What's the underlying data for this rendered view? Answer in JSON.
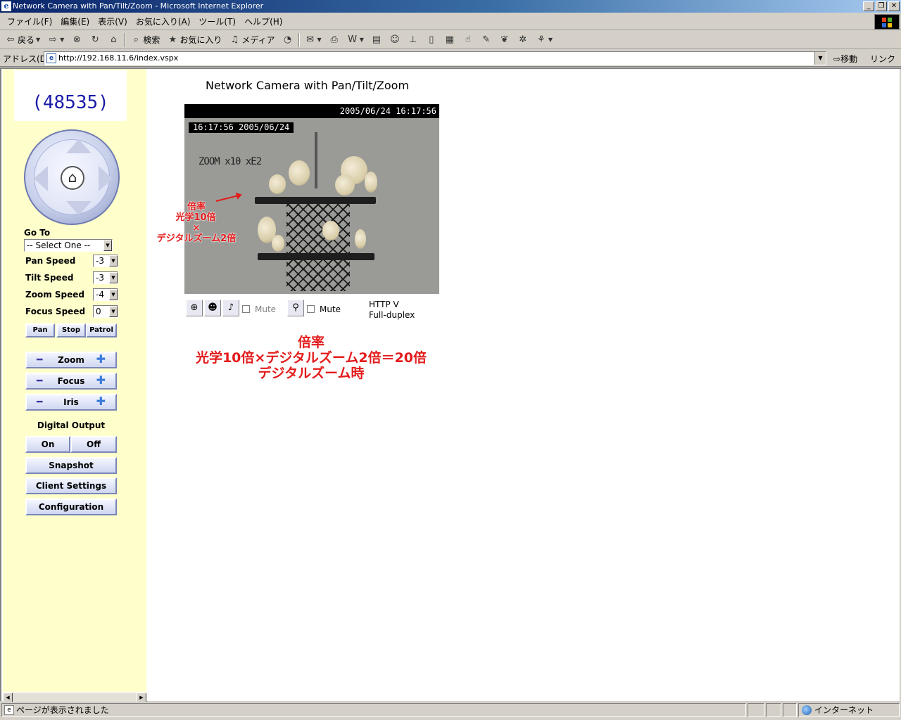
{
  "window": {
    "title": "Network Camera with Pan/Tilt/Zoom - Microsoft Internet Explorer",
    "controls": [
      "_",
      "❐",
      "✕"
    ]
  },
  "menubar": [
    "ファイル(F)",
    "編集(E)",
    "表示(V)",
    "お気に入り(A)",
    "ツール(T)",
    "ヘルプ(H)"
  ],
  "toolbar": {
    "back_label": "戻る",
    "search_label": "検索",
    "favorites_label": "お気に入り",
    "media_label": "メディア"
  },
  "address": {
    "label": "アドレス(D)",
    "url": "http://192.168.11.6/index.vspx",
    "go_label": "移動",
    "links_label": "リンク"
  },
  "left_panel": {
    "logo_text": "(48535)",
    "goto_label": "Go To",
    "goto_value": "-- Select One --",
    "speeds": [
      {
        "label": "Pan Speed",
        "value": "-3"
      },
      {
        "label": "Tilt Speed",
        "value": "-3"
      },
      {
        "label": "Zoom Speed",
        "value": "-4"
      },
      {
        "label": "Focus Speed",
        "value": "0"
      }
    ],
    "motion_buttons": [
      "Pan",
      "Stop",
      "Patrol"
    ],
    "adjust_buttons": [
      "Zoom",
      "Focus",
      "Iris"
    ],
    "digital_output_label": "Digital Output",
    "do_on": "On",
    "do_off": "Off",
    "snapshot_label": "Snapshot",
    "client_settings_label": "Client Settings",
    "configuration_label": "Configuration"
  },
  "main": {
    "title": "Network Camera with Pan/Tilt/Zoom",
    "camera_timestamp": "2005/06/24 16:17:56",
    "osd_time": "16:17:56 2005/06/24",
    "osd_zoom": "ZOOM x10 xE2",
    "annotation_small": [
      "倍率",
      "光学10倍",
      "×",
      "デジタルズーム2倍"
    ],
    "mute_label_1": "Mute",
    "mute_label_2": "Mute",
    "protocol_line1": "HTTP   V",
    "protocol_line2": "Full-duplex",
    "annotation_big": [
      "倍率",
      "光学10倍×デジタルズーム2倍＝20倍",
      "デジタルズーム時"
    ]
  },
  "statusbar": {
    "message": "ページが表示されました",
    "zone": "インターネット"
  }
}
